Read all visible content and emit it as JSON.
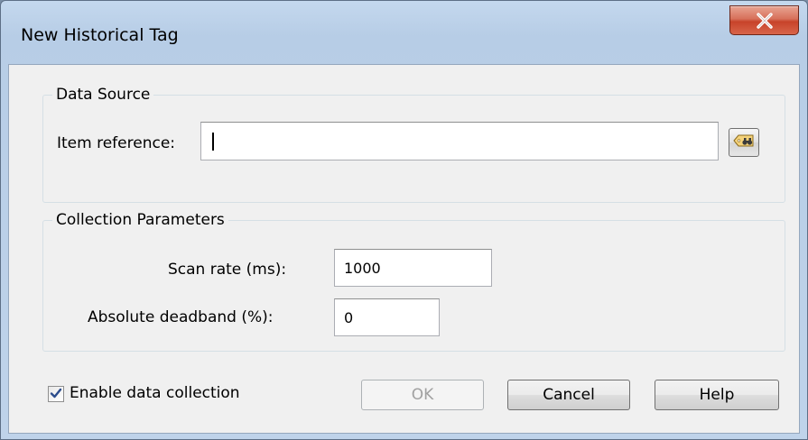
{
  "window": {
    "title": "New Historical Tag"
  },
  "data_source": {
    "legend": "Data Source",
    "item_reference_label": "Item reference:",
    "item_reference_value": ""
  },
  "collection": {
    "legend": "Collection Parameters",
    "scan_rate_label": "Scan rate (ms):",
    "scan_rate_value": "1000",
    "deadband_label": "Absolute deadband (%):",
    "deadband_value": "0"
  },
  "footer": {
    "enable_label": "Enable data collection",
    "enable_checked": true,
    "ok_label": "OK",
    "cancel_label": "Cancel",
    "help_label": "Help"
  },
  "icons": {
    "close": "close-icon",
    "browse": "tag-browse-icon",
    "check": "checkmark-icon"
  },
  "colors": {
    "close_button": "#c7432a",
    "client_bg": "#f0f0f0"
  }
}
